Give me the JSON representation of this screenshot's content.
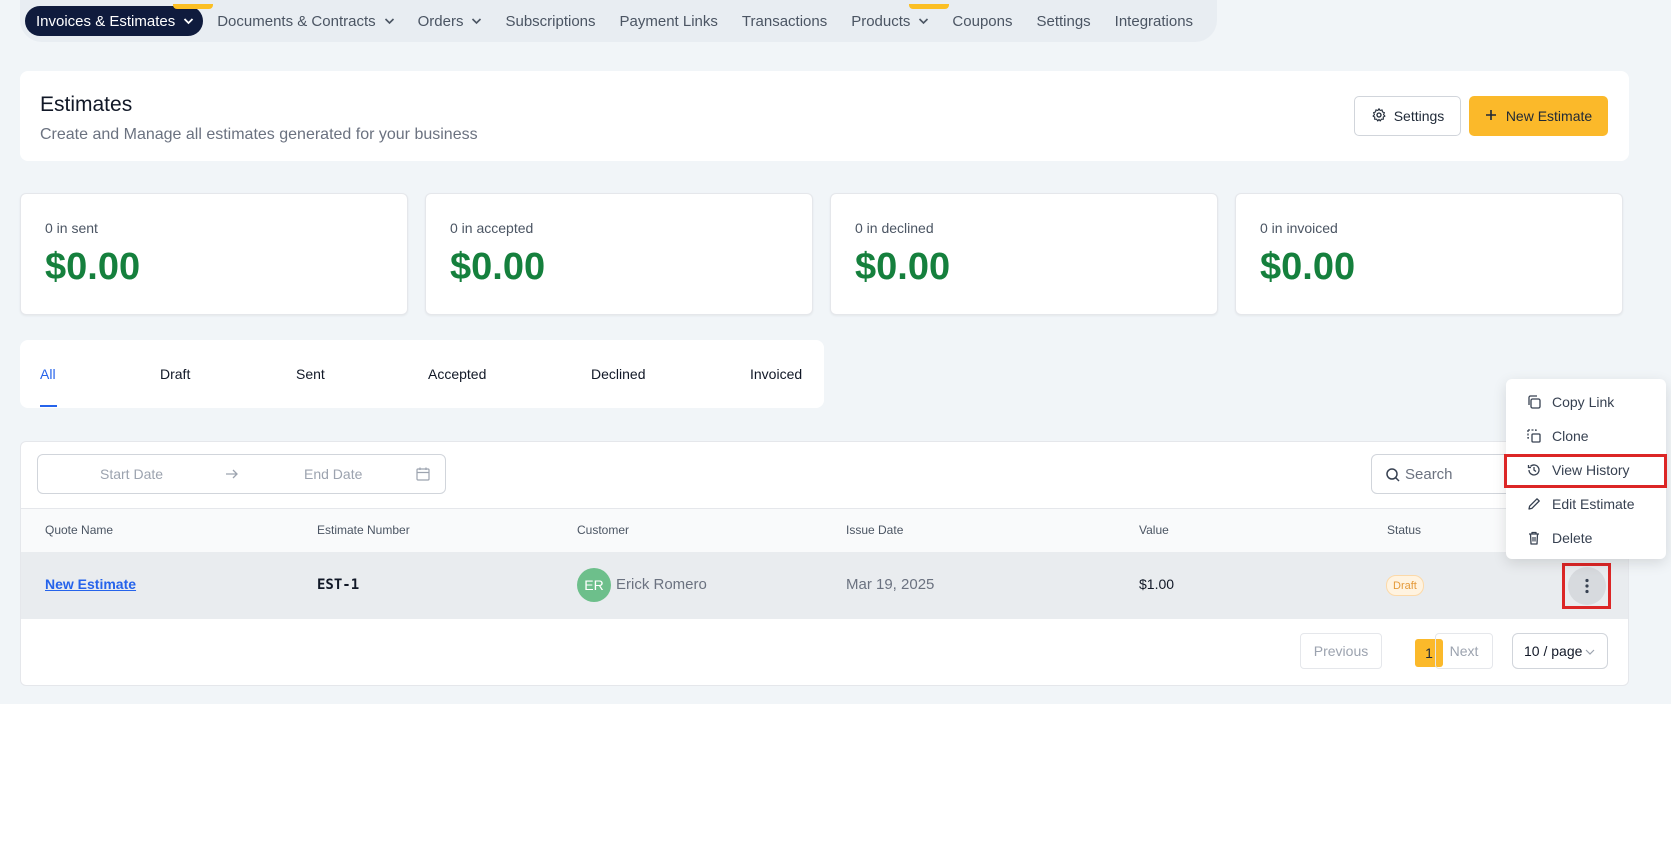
{
  "topnav": {
    "items": [
      {
        "label": "Invoices & Estimates",
        "active": true,
        "dropdown": true,
        "new_flag": true
      },
      {
        "label": "Documents & Contracts",
        "dropdown": true
      },
      {
        "label": "Orders",
        "dropdown": true
      },
      {
        "label": "Subscriptions"
      },
      {
        "label": "Payment Links"
      },
      {
        "label": "Transactions"
      },
      {
        "label": "Products",
        "dropdown": true,
        "new_flag": true
      },
      {
        "label": "Coupons"
      },
      {
        "label": "Settings"
      },
      {
        "label": "Integrations"
      }
    ]
  },
  "header": {
    "title": "Estimates",
    "subtitle": "Create and Manage all estimates generated for your business",
    "settings_label": "Settings",
    "new_label": "New Estimate"
  },
  "stats": [
    {
      "label": "0 in sent",
      "value": "$0.00"
    },
    {
      "label": "0 in accepted",
      "value": "$0.00"
    },
    {
      "label": "0 in declined",
      "value": "$0.00"
    },
    {
      "label": "0 in invoiced",
      "value": "$0.00"
    }
  ],
  "tabs": [
    "All",
    "Draft",
    "Sent",
    "Accepted",
    "Declined",
    "Invoiced"
  ],
  "filters": {
    "start_placeholder": "Start Date",
    "end_placeholder": "End Date",
    "search_placeholder": "Search"
  },
  "table": {
    "columns": [
      "Quote Name",
      "Estimate Number",
      "Customer",
      "Issue Date",
      "Value",
      "Status"
    ],
    "rows": [
      {
        "quote_name": "New Estimate",
        "estimate_number": "EST-1",
        "customer_initials": "ER",
        "customer": "Erick Romero",
        "issue_date": "Mar 19, 2025",
        "value": "$1.00",
        "status": "Draft"
      }
    ]
  },
  "pagination": {
    "previous": "Previous",
    "current_page": "1",
    "next": "Next",
    "per_page": "10 / page"
  },
  "row_menu": {
    "items": [
      "Copy Link",
      "Clone",
      "View History",
      "Edit Estimate",
      "Delete"
    ]
  },
  "colors": {
    "nav_active": "#0f1b3d",
    "accent": "#fbb92a",
    "stat_value": "#15803d",
    "link": "#2563eb",
    "highlight": "#dc2626"
  }
}
